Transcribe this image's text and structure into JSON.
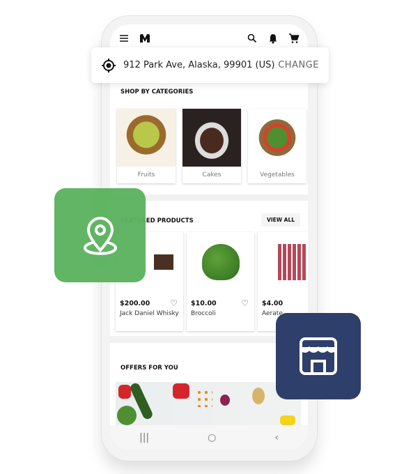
{
  "header": {
    "menu_icon": "hamburger-icon",
    "logo_icon": "m-logo-icon",
    "actions": [
      "search-icon",
      "bell-icon",
      "cart-icon"
    ]
  },
  "address": {
    "icon": "location-target-icon",
    "text": "912 Park Ave, Alaska, 99901 (US)",
    "change_label": "CHANGE"
  },
  "categories": {
    "title": "SHOP BY CATEGORIES",
    "items": [
      {
        "label": "Fruits"
      },
      {
        "label": "Cakes"
      },
      {
        "label": "Vegetables"
      }
    ]
  },
  "featured": {
    "title": "FEATURED PRODUCTS",
    "view_all": "VIEW ALL",
    "products": [
      {
        "price": "$200.00",
        "name": "Jack Daniel Whisky"
      },
      {
        "price": "$10.00",
        "name": "Broccoli"
      },
      {
        "price": "$4.00",
        "name": "Aerate"
      }
    ]
  },
  "offers": {
    "title": "OFFERS FOR YOU"
  },
  "nav": {
    "recent": "|||",
    "home": "○",
    "back": "‹"
  },
  "badges": {
    "location": {
      "icon": "map-pin-icon",
      "color": "#5cb35f"
    },
    "store": {
      "icon": "storefront-icon",
      "color": "#2f3f6b"
    }
  }
}
